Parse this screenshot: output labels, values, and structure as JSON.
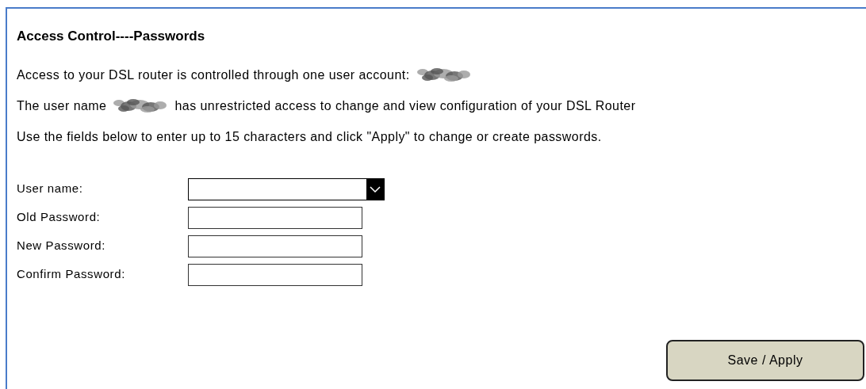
{
  "title": "Access Control----Passwords",
  "paragraphs": [
    {
      "parts": [
        {
          "kind": "text",
          "text": "Access to your DSL router is controlled through one user account:"
        },
        {
          "kind": "redacted"
        }
      ]
    },
    {
      "parts": [
        {
          "kind": "text",
          "text": "The user name"
        },
        {
          "kind": "redacted"
        },
        {
          "kind": "text",
          "text": "has unrestricted access to change and view configuration of your DSL Router"
        }
      ]
    },
    {
      "parts": [
        {
          "kind": "text",
          "text": "Use the fields below to enter up to 15 characters and click \"Apply\" to change or create passwords."
        }
      ]
    }
  ],
  "fields": [
    {
      "label": "User name:",
      "kind": "select"
    },
    {
      "label": "Old Password:",
      "kind": "password"
    },
    {
      "label": "New Password:",
      "kind": "password"
    },
    {
      "label": "Confirm Password:",
      "kind": "password"
    }
  ],
  "button": "Save / Apply"
}
